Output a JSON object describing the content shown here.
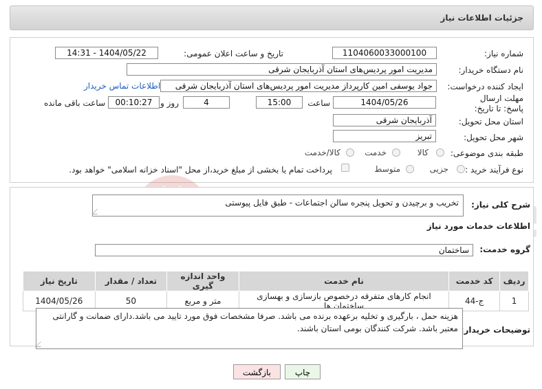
{
  "header": {
    "title": "جزئیات اطلاعات نیاز"
  },
  "form": {
    "need_number_label": "شماره نیاز:",
    "need_number": "1104060033000100",
    "announce_label": "تاریخ و ساعت اعلان عمومی:",
    "announce_value": "1404/05/22 - 14:31",
    "buyer_org_label": "نام دستگاه خریدار:",
    "buyer_org": "مدیریت امور پردیس‌های استان آذربایجان شرقی",
    "creator_label": "ایجاد کننده درخواست:",
    "creator": "جواد یوسفی امین کارپرداز مدیریت امور پردیس‌های استان آذربایجان شرقی",
    "contact_link": "اطلاعات تماس خریدار",
    "deadline_label": "مهلت ارسال پاسخ: تا تاریخ:",
    "deadline_date": "1404/05/26",
    "time_label": "ساعت",
    "deadline_time": "15:00",
    "days_value": "4",
    "days_label": "روز و",
    "remaining_time": "00:10:27",
    "remaining_label": "ساعت باقی مانده",
    "province_label": "استان محل تحویل:",
    "province": "آذربایجان شرقی",
    "city_label": "شهر محل تحویل:",
    "city": "تبریز",
    "category_label": "طبقه بندی موضوعی:",
    "category_options": [
      "کالا",
      "خدمت",
      "کالا/خدمت"
    ],
    "process_label": "نوع فرآیند خرید :",
    "process_options": [
      "جزیی",
      "متوسط"
    ],
    "payment_note": "پرداخت تمام یا بخشی از مبلغ خرید،از محل \"اسناد خزانه اسلامی\" خواهد بود."
  },
  "summary": {
    "label": "شرح کلی نیاز:",
    "text": "تخریب و برچیدن و تحویل پنجره سالن اجتماعات - طبق فایل پیوستی"
  },
  "services": {
    "section_title": "اطلاعات خدمات مورد نیاز",
    "group_label": "گروه خدمت:",
    "group_value": "ساختمان",
    "columns": [
      "ردیف",
      "کد خدمت",
      "نام خدمت",
      "واحد اندازه گیری",
      "تعداد / مقدار",
      "تاریخ نیاز"
    ],
    "rows": [
      [
        "1",
        "ج-44",
        "انجام کارهای متفرقه درخصوص بازسازی و بهسازی ساختمان ها",
        "متر و مربع",
        "50",
        "1404/05/26"
      ]
    ]
  },
  "buyer_notes": {
    "label": "توضیحات خریدار:",
    "text": "هزینه حمل ، بارگیری و تخلیه برعهده برنده می باشد. صرفا مشخصات فوق مورد تایید می باشد.دارای ضمانت و گارانتی معتبر باشد. شرکت کنندگان بومی استان باشند."
  },
  "buttons": {
    "print": "چاپ",
    "back": "بازگشت"
  },
  "watermark": {
    "text": "AriaTender.neT"
  },
  "colors": {
    "header_bg": "#d9d9d9",
    "link": "#1d5ec2",
    "back_btn": "#fbe3e3",
    "print_btn": "#eaf7e6",
    "watermark": "#c0392b"
  }
}
